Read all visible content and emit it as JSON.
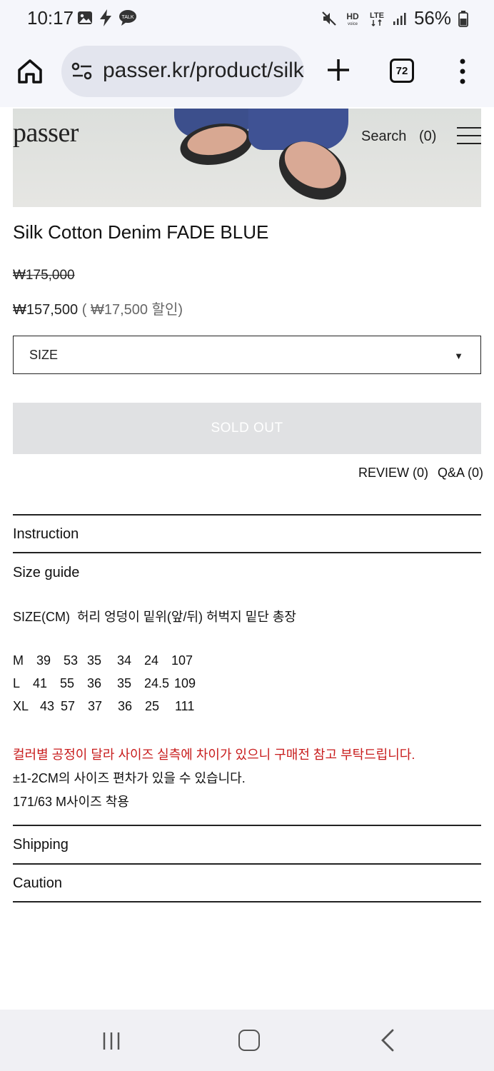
{
  "status_bar": {
    "time": "10:17",
    "battery": "56%",
    "network": "LTE",
    "left_icons": [
      "gallery-icon",
      "flash-icon",
      "talk-icon"
    ],
    "right_icons": [
      "mute-icon",
      "hd-voice-icon",
      "lte-icon",
      "signal-icon",
      "battery-icon"
    ]
  },
  "browser": {
    "url": "passer.kr/product/silk-cotton-denim",
    "tab_count": "72"
  },
  "site": {
    "logo": "passer",
    "search": "Search",
    "cart": "(0)"
  },
  "product": {
    "title": "Silk Cotton Denim FADE BLUE",
    "price_original": "₩175,000",
    "price_sale": "₩157,500",
    "price_discount": "( ₩17,500 할인)",
    "size_select": "SIZE",
    "sold_out": "SOLD OUT",
    "review": "REVIEW (0)",
    "qa": "Q&A (0)"
  },
  "sections": {
    "instruction": "Instruction",
    "size_guide": "Size guide",
    "shipping": "Shipping",
    "caution": "Caution"
  },
  "size_guide": {
    "header": "SIZE(CM)  허리 엉덩이 밑위(앞/뒤) 허벅지 밑단 총장",
    "rows": [
      [
        "M",
        "39",
        "53",
        "35",
        "34",
        "24",
        "107"
      ],
      [
        "L",
        "41",
        "55",
        "36",
        "35",
        "24.5",
        "109"
      ],
      [
        "XL",
        "43",
        "57",
        "37",
        "36",
        "25",
        "111"
      ]
    ],
    "note_red": "컬러별 공정이 달라 사이즈 실측에 차이가 있으니 구매전 참고 부탁드립니다.",
    "note_tolerance": "±1-2CM의 사이즈 편차가 있을 수 있습니다.",
    "note_model": "171/63 M사이즈 착용"
  },
  "colors": {
    "accent_red": "#c81c1c",
    "sold_out_bg": "#e0e1e3"
  }
}
